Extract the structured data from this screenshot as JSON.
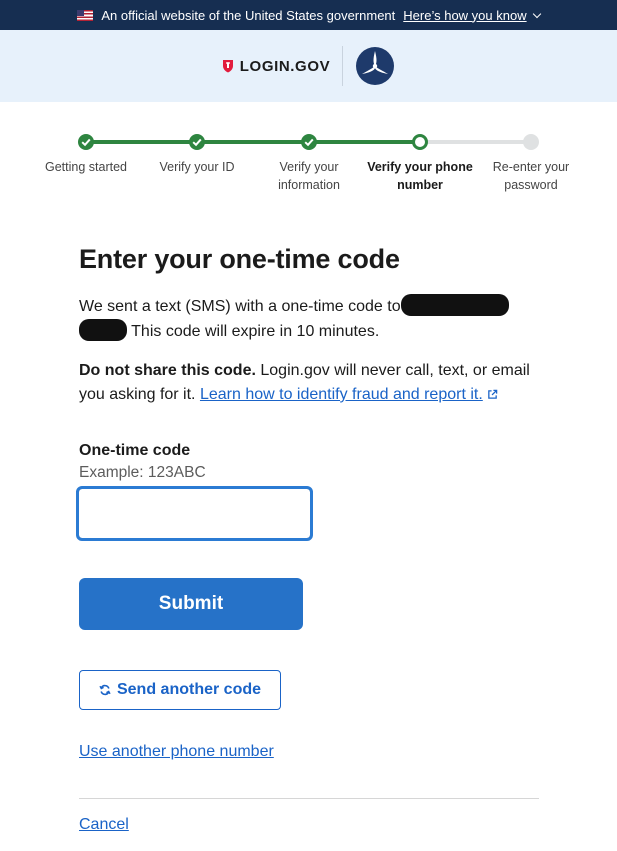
{
  "banner": {
    "text": "An official website of the United States government",
    "link_label": "Here’s how you know"
  },
  "header": {
    "brand": "LOGIN.GOV"
  },
  "steps": [
    {
      "label_line1": "Getting started",
      "label_line2": "",
      "status": "complete"
    },
    {
      "label_line1": "Verify your ID",
      "label_line2": "",
      "status": "complete"
    },
    {
      "label_line1": "Verify your",
      "label_line2": "information",
      "status": "complete"
    },
    {
      "label_line1": "Verify your phone",
      "label_line2": "number",
      "status": "current"
    },
    {
      "label_line1": "Re-enter your",
      "label_line2": "password",
      "status": "incomplete"
    }
  ],
  "page": {
    "title": "Enter your one-time code",
    "sent_text": "We sent a text (SMS) with a one-time code to",
    "expire_text": "This code will expire in 10 minutes.",
    "warning_bold": "Do not share this code.",
    "warning_text": "Login.gov will never call, text, or email you asking for it.",
    "fraud_link": "Learn how to identify fraud and report it."
  },
  "form": {
    "code_label": "One-time code",
    "code_hint": "Example: 123ABC",
    "code_value": "",
    "submit_label": "Submit",
    "resend_label": "Send another code",
    "alt_phone_label": "Use another phone number",
    "cancel_label": "Cancel"
  },
  "colors": {
    "banner_bg": "#162e51",
    "header_bg": "#e7f1fb",
    "step_complete": "#2e8540",
    "step_incomplete": "#dfe1e2",
    "primary": "#2672c8",
    "link": "#1a63c7"
  }
}
